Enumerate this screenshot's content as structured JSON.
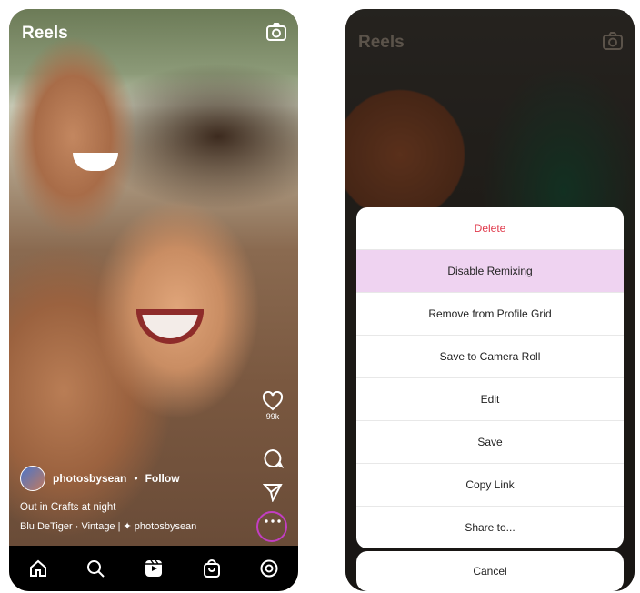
{
  "left_screen": {
    "title": "Reels",
    "likes_count": "99k",
    "username": "photosbysean",
    "separator": "•",
    "follow_label": "Follow",
    "caption": "Out in Crafts at night",
    "audio_label": "Blu DeTiger · Vintage | ✦ photosbysean",
    "icons": {
      "camera": "camera-icon",
      "like": "heart-icon",
      "comment": "comment-icon",
      "share": "send-icon",
      "more": "more-icon",
      "nav": [
        "home-icon",
        "search-icon",
        "reels-icon",
        "shop-icon",
        "profile-icon"
      ]
    },
    "highlight_color": "#c23ec2"
  },
  "right_screen": {
    "title": "Reels",
    "menu_items": [
      {
        "label": "Delete",
        "style": "danger"
      },
      {
        "label": "Disable Remixing",
        "style": "highlight"
      },
      {
        "label": "Remove from Profile Grid",
        "style": "normal"
      },
      {
        "label": "Save to Camera Roll",
        "style": "normal"
      },
      {
        "label": "Edit",
        "style": "normal"
      },
      {
        "label": "Save",
        "style": "normal"
      },
      {
        "label": "Copy Link",
        "style": "normal"
      },
      {
        "label": "Share to...",
        "style": "normal"
      }
    ],
    "cancel_label": "Cancel",
    "colors": {
      "danger": "#e0384a",
      "highlight": "#efd3f1"
    }
  }
}
